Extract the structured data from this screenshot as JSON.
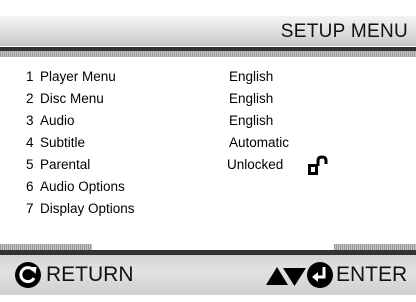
{
  "header": {
    "title": "SETUP MENU"
  },
  "menu": {
    "items": [
      {
        "number": "1",
        "label": "Player Menu",
        "value": "English"
      },
      {
        "number": "2",
        "label": "Disc Menu",
        "value": "English"
      },
      {
        "number": "3",
        "label": "Audio",
        "value": "English"
      },
      {
        "number": "4",
        "label": "Subtitle",
        "value": "Automatic"
      },
      {
        "number": "5",
        "label": "Parental",
        "value": "Unlocked",
        "value_icon": "unlocked-padlock-icon"
      },
      {
        "number": "6",
        "label": "Audio Options",
        "value": ""
      },
      {
        "number": "7",
        "label": "Display Options",
        "value": ""
      }
    ]
  },
  "footer": {
    "return_label": "RETURN",
    "return_icon": "return-circular-arrow-icon",
    "nav_icon": "up-down-arrows-icon",
    "enter_label": "ENTER",
    "enter_icon": "enter-arrow-icon"
  }
}
